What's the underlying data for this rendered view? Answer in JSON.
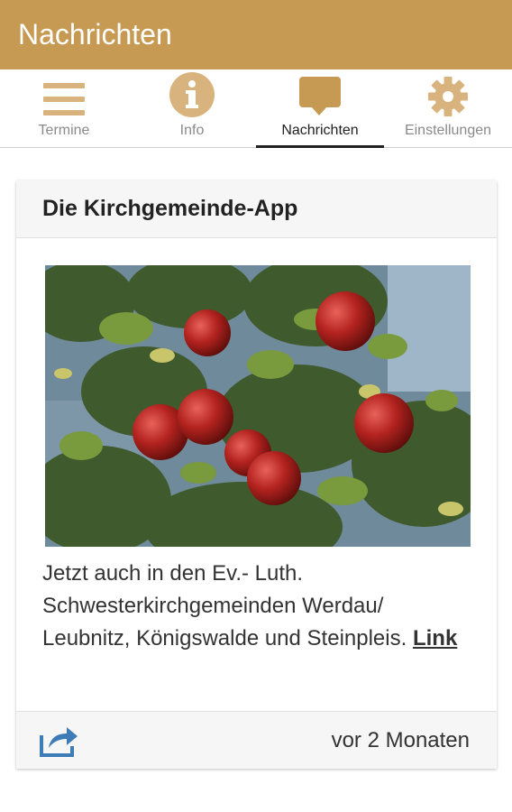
{
  "app_bar": {
    "title": "Nachrichten"
  },
  "tabs": [
    {
      "label": "Termine",
      "icon": "menu-icon",
      "active": false
    },
    {
      "label": "Info",
      "icon": "info-icon",
      "active": false
    },
    {
      "label": "Nachrichten",
      "icon": "chat-bubble-icon",
      "active": true
    },
    {
      "label": "Einstellungen",
      "icon": "gear-icon",
      "active": false
    }
  ],
  "colors": {
    "accent": "#c69a53",
    "tab_active_text": "#222222",
    "tab_inactive_text": "#8a8a8a"
  },
  "card": {
    "title": "Die Kirchgemeinde-App",
    "image": "apple-tree-photo",
    "text": "Jetzt auch in den Ev.- Luth. Schwesterkirchgemeinden Werdau/ Leubnitz, Königswalde und Steinpleis.",
    "link_label": "Link",
    "share_icon": "share-icon",
    "timestamp": "vor 2 Monaten"
  }
}
